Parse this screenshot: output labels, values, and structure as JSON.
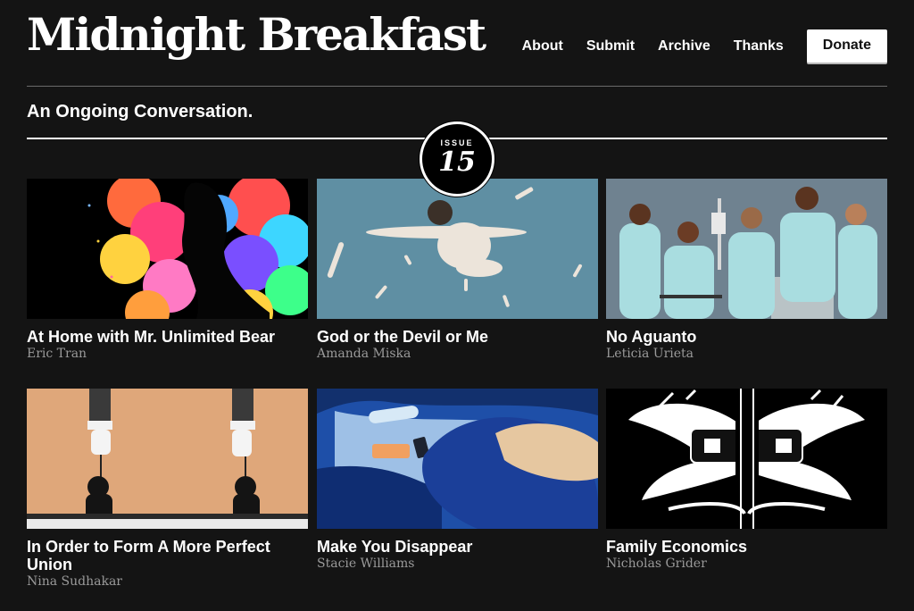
{
  "site": {
    "title": "Midnight Breakfast",
    "tagline": "An Ongoing Conversation."
  },
  "nav": {
    "items": [
      {
        "label": "About"
      },
      {
        "label": "Submit"
      },
      {
        "label": "Archive"
      },
      {
        "label": "Thanks"
      }
    ],
    "donate_label": "Donate"
  },
  "issue": {
    "label": "ISSUE",
    "number": "15"
  },
  "articles": [
    {
      "title": "At Home with Mr. Unlimited Bear",
      "author": "Eric Tran",
      "image": "colorful-smoke-silhouette-illustration"
    },
    {
      "title": "God or the Devil or Me",
      "author": "Amanda Miska",
      "image": "floating-girl-blue-background-illustration"
    },
    {
      "title": "No Aguanto",
      "author": "Leticia Urieta",
      "image": "women-in-hospital-gowns-illustration"
    },
    {
      "title": "In Order to Form A More Perfect Union",
      "author": "Nina Sudhakar",
      "image": "hands-holding-puppets-illustration"
    },
    {
      "title": "Make You Disappear",
      "author": "Stacie Williams",
      "image": "car-interior-items-illustration"
    },
    {
      "title": "Family Economics",
      "author": "Nicholas Grider",
      "image": "black-white-cross-wings-illustration"
    }
  ],
  "colors": {
    "background": "#141414",
    "text": "#ffffff",
    "author": "#9a9a9a"
  }
}
